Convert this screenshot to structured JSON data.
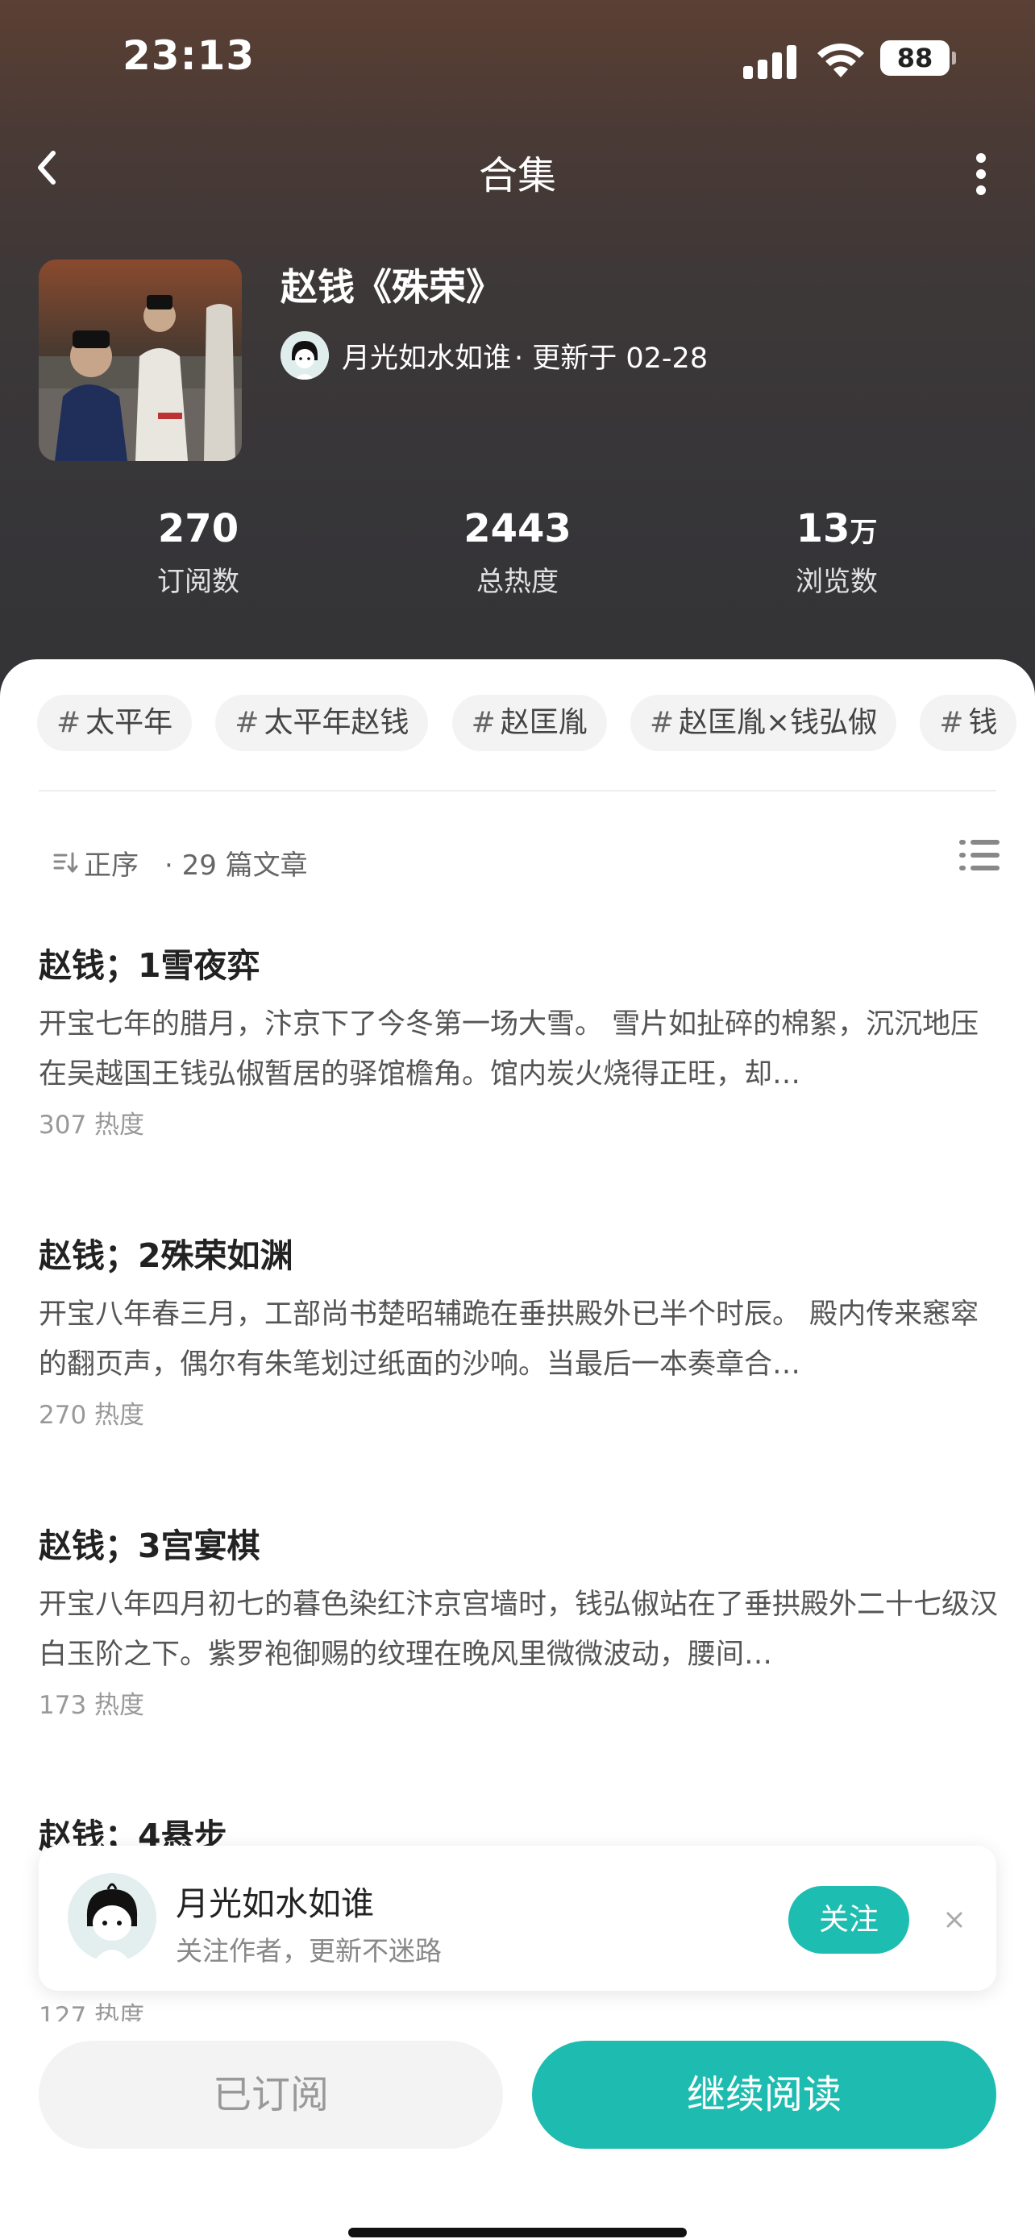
{
  "status_bar": {
    "time": "23:13",
    "battery": "88"
  },
  "nav": {
    "title": "合集"
  },
  "collection": {
    "title": "赵钱《殊荣》",
    "author": "月光如水如谁",
    "update_text": "· 更新于 02-28"
  },
  "stats": [
    {
      "value": "270",
      "unit": "",
      "label": "订阅数"
    },
    {
      "value": "2443",
      "unit": "",
      "label": "总热度"
    },
    {
      "value": "13",
      "unit": "万",
      "label": "浏览数"
    }
  ],
  "tags": [
    {
      "hash": "#",
      "label": "太平年"
    },
    {
      "hash": "#",
      "label": "太平年赵钱"
    },
    {
      "hash": "#",
      "label": "赵匡胤"
    },
    {
      "hash": "#",
      "label": "赵匡胤×钱弘俶"
    },
    {
      "hash": "#",
      "label": "钱"
    }
  ],
  "sort": {
    "label": "正序",
    "count": "· 29 篇文章"
  },
  "articles": [
    {
      "title": "赵钱；1雪夜弈",
      "excerpt": "开宝七年的腊月，汴京下了今冬第一场大雪。 雪片如扯碎的棉絮，沉沉地压在吴越国王钱弘俶暂居的驿馆檐角。馆内炭火烧得正旺，却…",
      "heat": "307 热度"
    },
    {
      "title": "赵钱；2殊荣如渊",
      "excerpt": "开宝八年春三月，工部尚书楚昭辅跪在垂拱殿外已半个时辰。 殿内传来窸窣的翻页声，偶尔有朱笔划过纸面的沙响。当最后一本奏章合…",
      "heat": "270 热度"
    },
    {
      "title": "赵钱；3宫宴棋",
      "excerpt": "开宝八年四月初七的暮色染红汴京宫墙时，钱弘俶站在了垂拱殿外二十七级汉白玉阶之下。紫罗袍御赐的纹理在晚风里微微波动，腰间…",
      "heat": "173 热度"
    },
    {
      "title": "赵钱；4悬步",
      "excerpt": "",
      "heat": "127 热度"
    }
  ],
  "follow_card": {
    "name": "月光如水如谁",
    "hint": "关注作者，更新不迷路",
    "button": "关注"
  },
  "bottom": {
    "subscribed": "已订阅",
    "continue": "继续阅读"
  },
  "colors": {
    "accent": "#1ebcb0",
    "header_bg": "#3a3637"
  }
}
